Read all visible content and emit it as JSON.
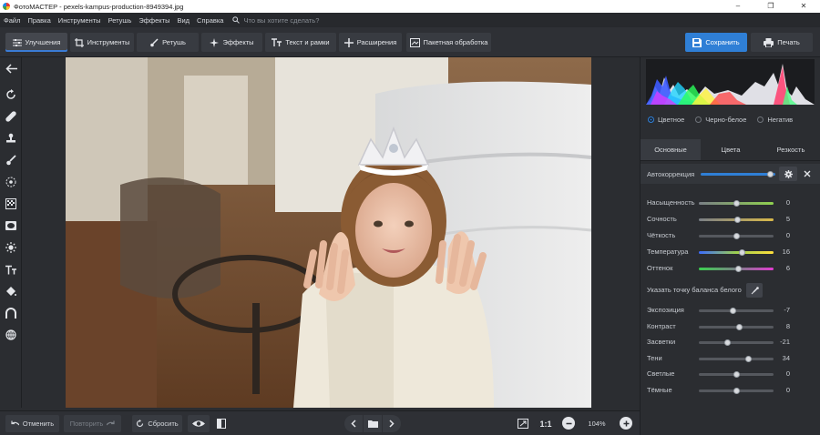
{
  "window": {
    "title": "ФотоМАСТЕР - pexels-kampus-production-8949394.jpg"
  },
  "menu": {
    "items": [
      "Файл",
      "Правка",
      "Инструменты",
      "Ретушь",
      "Эффекты",
      "Вид",
      "Справка"
    ],
    "search_placeholder": "Что вы хотите сделать?"
  },
  "toolbar": {
    "tabs": [
      "Улучшения",
      "Инструменты",
      "Ретушь",
      "Эффекты",
      "Текст и рамки",
      "Расширения",
      "Пакетная обработка"
    ],
    "save_label": "Сохранить",
    "print_label": "Печать"
  },
  "bottombar": {
    "undo_label": "Отменить",
    "redo_label": "Повторить",
    "reset_label": "Сбросить",
    "actual_size_label": "1:1",
    "zoom_label": "104%"
  },
  "panel": {
    "modes": [
      "Цветное",
      "Черно-белое",
      "Негатив"
    ],
    "tabs": [
      "Основные",
      "Цвета",
      "Резкость"
    ],
    "autocorrection": {
      "label": "Автокоррекция",
      "level": 0.93
    },
    "white_balance_label": "Указать точку баланса белого",
    "group1": [
      {
        "label": "Насыщенность",
        "value": "0",
        "level": 0.5
      },
      {
        "label": "Сочность",
        "value": "5",
        "level": 0.52
      },
      {
        "label": "Чёткость",
        "value": "0",
        "level": 0.5
      },
      {
        "label": "Температура",
        "value": "16",
        "level": 0.58
      },
      {
        "label": "Оттенок",
        "value": "6",
        "level": 0.53
      }
    ],
    "group2": [
      {
        "label": "Экспозиция",
        "value": "-7",
        "level": 0.46
      },
      {
        "label": "Контраст",
        "value": "8",
        "level": 0.54
      },
      {
        "label": "Засветки",
        "value": "-21",
        "level": 0.39
      },
      {
        "label": "Тени",
        "value": "34",
        "level": 0.67
      },
      {
        "label": "Светлые",
        "value": "0",
        "level": 0.5
      },
      {
        "label": "Тёмные",
        "value": "0",
        "level": 0.5
      }
    ]
  },
  "colors": {
    "accent": "#2f7fd6",
    "panel": "#2b2d31",
    "toolbar": "#2e3035"
  }
}
